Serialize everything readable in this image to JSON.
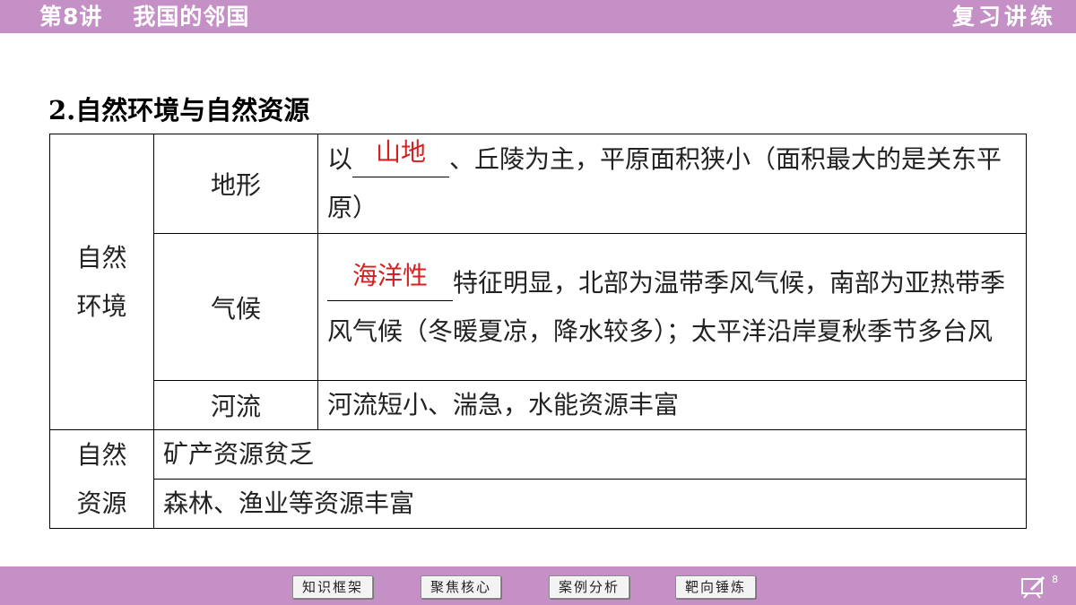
{
  "header": {
    "lesson": "第8讲",
    "title": "我国的邻国",
    "right_label": "复习讲练"
  },
  "section_title": "2.自然环境与自然资源",
  "table": {
    "env_category": [
      "自然",
      "环境"
    ],
    "res_category": [
      "自然",
      "资源"
    ],
    "terrain": {
      "label": "地形",
      "prefix": "以",
      "blank": "山地",
      "rest": "、丘陵为主，平原面积狭小（面积最大的是关东平原）"
    },
    "climate": {
      "label": "气候",
      "blank": "海洋性",
      "rest": "特征明显，北部为温带季风气候，南部为亚热带季风气候（冬暖夏凉，降水较多）；太平洋沿岸夏秋季节多台风"
    },
    "river": {
      "label": "河流",
      "text": "河流短小、湍急，水能资源丰富"
    },
    "resources": [
      "矿产资源贫乏",
      "森林、渔业等资源丰富"
    ]
  },
  "footer": {
    "nav": [
      "知识框架",
      "聚焦核心",
      "案例分析",
      "靶向锤炼"
    ],
    "page_number": "8"
  },
  "colors": {
    "bar": "#c490c6",
    "answer": "#d42020"
  }
}
